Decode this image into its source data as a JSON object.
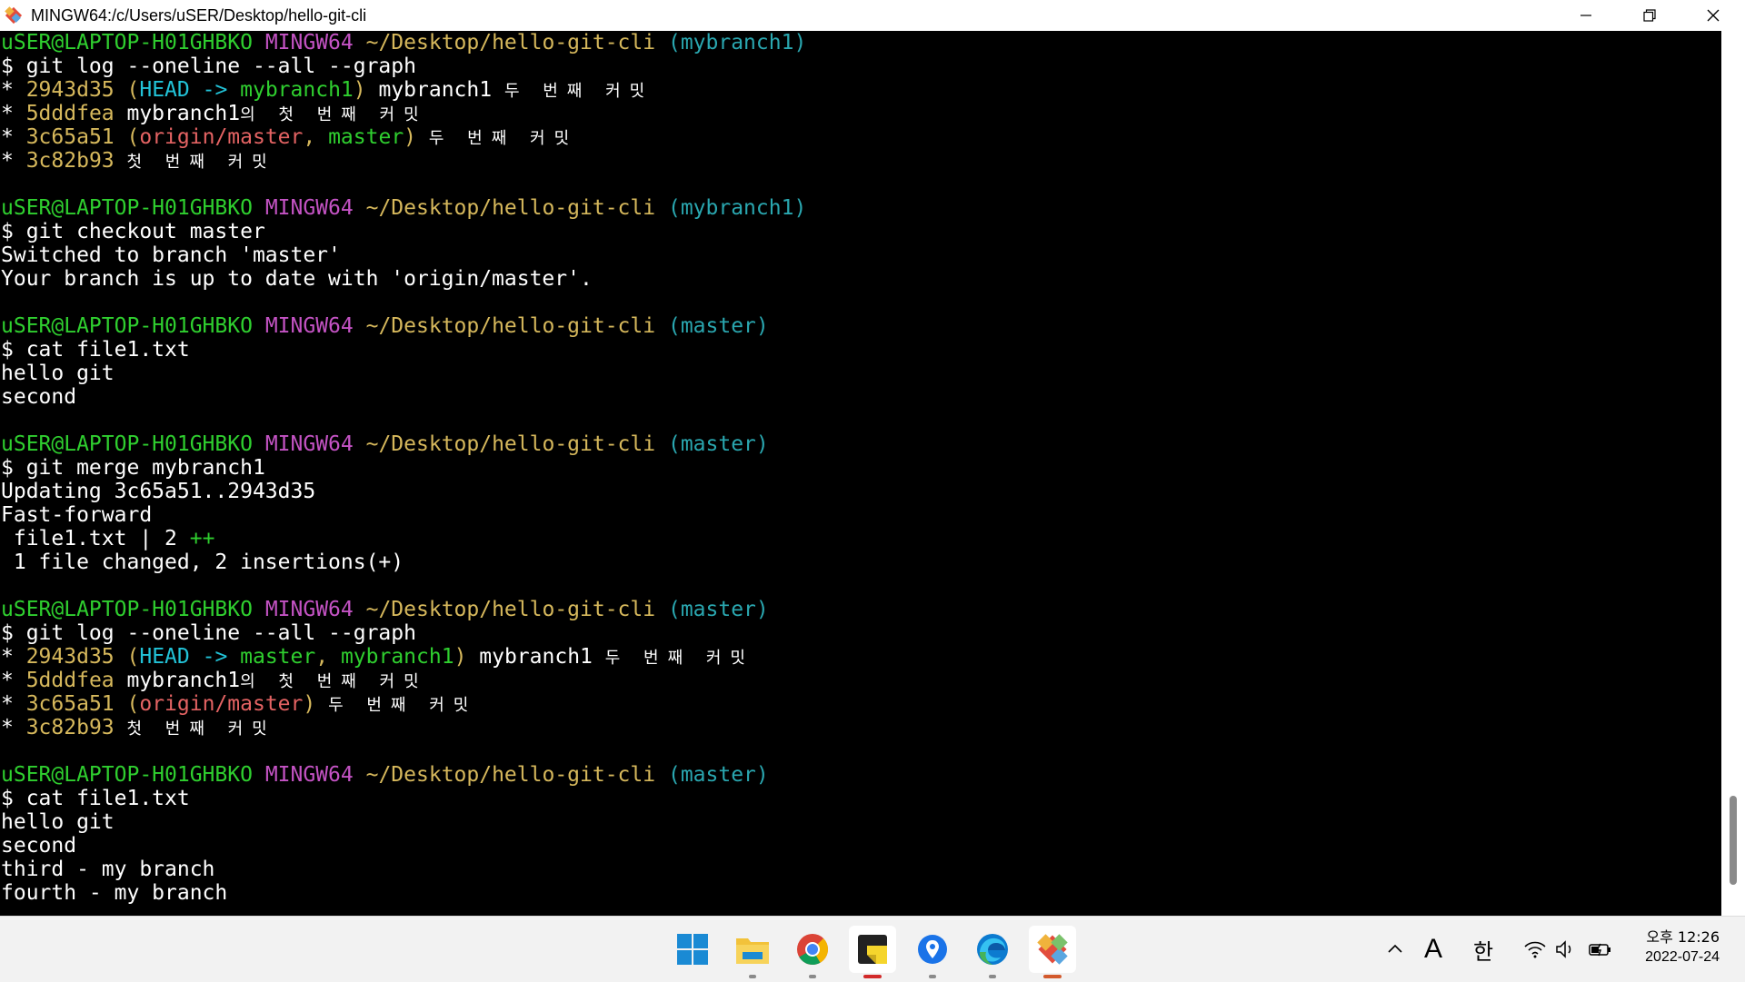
{
  "window": {
    "title": "MINGW64:/c/Users/uSER/Desktop/hello-git-cli",
    "controls": [
      "minimize-icon",
      "restore-icon",
      "close-icon"
    ]
  },
  "terminal": {
    "colors": {
      "user": "#2fcf2f",
      "shell": "#c453c4",
      "path": "#d6b85c",
      "branch": "#2aa7b0",
      "hash": "#d6b85c",
      "head": "#22c3d8",
      "local_branch": "#2fcf2f",
      "remote_branch": "#e46363",
      "text": "#ffffff",
      "background": "#000000"
    },
    "lines": [
      [
        {
          "t": "uSER@LAPTOP-H01GHBKO",
          "c": "u"
        },
        {
          "t": " "
        },
        {
          "t": "MINGW64",
          "c": "m"
        },
        {
          "t": " "
        },
        {
          "t": "~/Desktop/hello-git-cli",
          "c": "p"
        },
        {
          "t": " "
        },
        {
          "t": "(mybranch1)",
          "c": "br"
        }
      ],
      [
        {
          "t": "$ git log --oneline --all --graph"
        }
      ],
      [
        {
          "t": "* "
        },
        {
          "t": "2943d35",
          "c": "y"
        },
        {
          "t": " "
        },
        {
          "t": "(",
          "c": "y"
        },
        {
          "t": "HEAD -> ",
          "c": "c"
        },
        {
          "t": "mybranch1",
          "c": "g"
        },
        {
          "t": ")",
          "c": "y"
        },
        {
          "t": " mybranch1 "
        },
        {
          "t": "두 번째 커밋",
          "c": "ko"
        }
      ],
      [
        {
          "t": "* "
        },
        {
          "t": "5dddfea",
          "c": "y"
        },
        {
          "t": " mybranch1"
        },
        {
          "t": "의 첫 번째 커밋",
          "c": "ko"
        }
      ],
      [
        {
          "t": "* "
        },
        {
          "t": "3c65a51",
          "c": "y"
        },
        {
          "t": " "
        },
        {
          "t": "(",
          "c": "y"
        },
        {
          "t": "origin/master",
          "c": "r"
        },
        {
          "t": ", ",
          "c": "y"
        },
        {
          "t": "master",
          "c": "g"
        },
        {
          "t": ")",
          "c": "y"
        },
        {
          "t": " "
        },
        {
          "t": "두 번째 커밋",
          "c": "ko"
        }
      ],
      [
        {
          "t": "* "
        },
        {
          "t": "3c82b93",
          "c": "y"
        },
        {
          "t": " "
        },
        {
          "t": "첫 번째 커밋",
          "c": "ko"
        }
      ],
      [],
      [
        {
          "t": "uSER@LAPTOP-H01GHBKO",
          "c": "u"
        },
        {
          "t": " "
        },
        {
          "t": "MINGW64",
          "c": "m"
        },
        {
          "t": " "
        },
        {
          "t": "~/Desktop/hello-git-cli",
          "c": "p"
        },
        {
          "t": " "
        },
        {
          "t": "(mybranch1)",
          "c": "br"
        }
      ],
      [
        {
          "t": "$ git checkout master"
        }
      ],
      [
        {
          "t": "Switched to branch 'master'"
        }
      ],
      [
        {
          "t": "Your branch is up to date with 'origin/master'."
        }
      ],
      [],
      [
        {
          "t": "uSER@LAPTOP-H01GHBKO",
          "c": "u"
        },
        {
          "t": " "
        },
        {
          "t": "MINGW64",
          "c": "m"
        },
        {
          "t": " "
        },
        {
          "t": "~/Desktop/hello-git-cli",
          "c": "p"
        },
        {
          "t": " "
        },
        {
          "t": "(master)",
          "c": "br"
        }
      ],
      [
        {
          "t": "$ cat file1.txt"
        }
      ],
      [
        {
          "t": "hello git"
        }
      ],
      [
        {
          "t": "second"
        }
      ],
      [],
      [
        {
          "t": "uSER@LAPTOP-H01GHBKO",
          "c": "u"
        },
        {
          "t": " "
        },
        {
          "t": "MINGW64",
          "c": "m"
        },
        {
          "t": " "
        },
        {
          "t": "~/Desktop/hello-git-cli",
          "c": "p"
        },
        {
          "t": " "
        },
        {
          "t": "(master)",
          "c": "br"
        }
      ],
      [
        {
          "t": "$ git merge mybranch1"
        }
      ],
      [
        {
          "t": "Updating 3c65a51..2943d35"
        }
      ],
      [
        {
          "t": "Fast-forward"
        }
      ],
      [
        {
          "t": " file1.txt | 2 "
        },
        {
          "t": "++",
          "c": "g"
        }
      ],
      [
        {
          "t": " 1 file changed, 2 insertions(+)"
        }
      ],
      [],
      [
        {
          "t": "uSER@LAPTOP-H01GHBKO",
          "c": "u"
        },
        {
          "t": " "
        },
        {
          "t": "MINGW64",
          "c": "m"
        },
        {
          "t": " "
        },
        {
          "t": "~/Desktop/hello-git-cli",
          "c": "p"
        },
        {
          "t": " "
        },
        {
          "t": "(master)",
          "c": "br"
        }
      ],
      [
        {
          "t": "$ git log --oneline --all --graph"
        }
      ],
      [
        {
          "t": "* "
        },
        {
          "t": "2943d35",
          "c": "y"
        },
        {
          "t": " "
        },
        {
          "t": "(",
          "c": "y"
        },
        {
          "t": "HEAD -> ",
          "c": "c"
        },
        {
          "t": "master",
          "c": "g"
        },
        {
          "t": ", ",
          "c": "y"
        },
        {
          "t": "mybranch1",
          "c": "g"
        },
        {
          "t": ")",
          "c": "y"
        },
        {
          "t": " mybranch1 "
        },
        {
          "t": "두 번째 커밋",
          "c": "ko"
        }
      ],
      [
        {
          "t": "* "
        },
        {
          "t": "5dddfea",
          "c": "y"
        },
        {
          "t": " mybranch1"
        },
        {
          "t": "의 첫 번째 커밋",
          "c": "ko"
        }
      ],
      [
        {
          "t": "* "
        },
        {
          "t": "3c65a51",
          "c": "y"
        },
        {
          "t": " "
        },
        {
          "t": "(",
          "c": "y"
        },
        {
          "t": "origin/master",
          "c": "r"
        },
        {
          "t": ")",
          "c": "y"
        },
        {
          "t": " "
        },
        {
          "t": "두 번째 커밋",
          "c": "ko"
        }
      ],
      [
        {
          "t": "* "
        },
        {
          "t": "3c82b93",
          "c": "y"
        },
        {
          "t": " "
        },
        {
          "t": "첫 번째 커밋",
          "c": "ko"
        }
      ],
      [],
      [
        {
          "t": "uSER@LAPTOP-H01GHBKO",
          "c": "u"
        },
        {
          "t": " "
        },
        {
          "t": "MINGW64",
          "c": "m"
        },
        {
          "t": " "
        },
        {
          "t": "~/Desktop/hello-git-cli",
          "c": "p"
        },
        {
          "t": " "
        },
        {
          "t": "(master)",
          "c": "br"
        }
      ],
      [
        {
          "t": "$ cat file1.txt"
        }
      ],
      [
        {
          "t": "hello git"
        }
      ],
      [
        {
          "t": "second"
        }
      ],
      [
        {
          "t": "third - my branch"
        }
      ],
      [
        {
          "t": "fourth - my branch"
        }
      ]
    ]
  },
  "taskbar": {
    "apps": [
      {
        "name": "start-button",
        "icon": "windows-logo-icon"
      },
      {
        "name": "file-explorer",
        "icon": "folder-icon"
      },
      {
        "name": "chrome",
        "icon": "chrome-icon"
      },
      {
        "name": "sticky-notes",
        "icon": "sticky-notes-icon"
      },
      {
        "name": "maps",
        "icon": "map-pin-icon"
      },
      {
        "name": "edge",
        "icon": "edge-icon"
      },
      {
        "name": "git-bash",
        "icon": "git-icon"
      }
    ],
    "tray": {
      "ime_mode": "A",
      "ime_lang": "한",
      "icons": [
        "chevron-up-icon",
        "wifi-icon",
        "speaker-icon",
        "battery-icon"
      ]
    },
    "clock": {
      "time": "오후 12:26",
      "date": "2022-07-24"
    }
  }
}
